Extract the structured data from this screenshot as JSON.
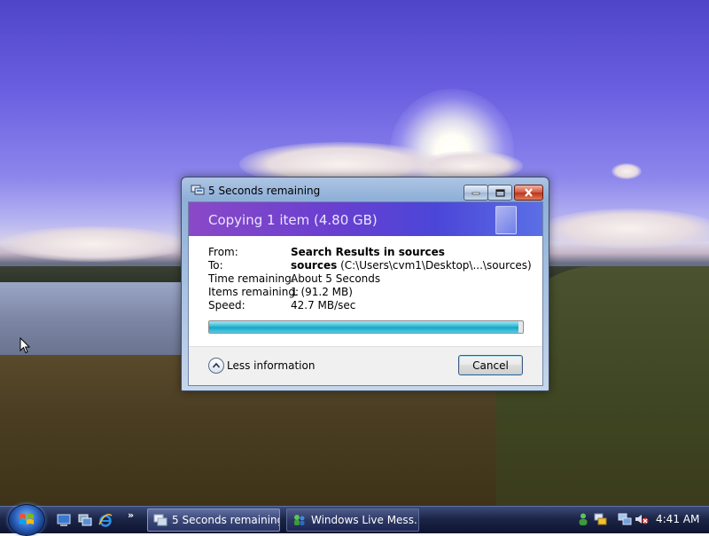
{
  "dialog": {
    "title": "5 Seconds remaining",
    "heading": "Copying 1 item (4.80 GB)",
    "from_label": "From:",
    "from_value": "Search Results in sources",
    "to_label": "To:",
    "to_value_bold": "sources",
    "to_value_path": "(C:\\Users\\cvm1\\Desktop\\...\\sources)",
    "time_label": "Time remaining:",
    "time_value": "About 5 Seconds",
    "items_label": "Items remaining:",
    "items_value": "1 (91.2 MB)",
    "speed_label": "Speed:",
    "speed_value": "42.7 MB/sec",
    "progress_fraction": 0.985,
    "less_info_label": "Less information",
    "cancel_label": "Cancel"
  },
  "taskbar": {
    "quick_launch": [
      "show-desktop-icon",
      "switch-windows-icon",
      "internet-explorer-icon"
    ],
    "overflow_label": "»",
    "tasks": [
      {
        "label": "5 Seconds remaining",
        "icon": "copy-icon"
      },
      {
        "label": "Windows Live Mess...",
        "icon": "messenger-icon"
      }
    ],
    "tray_icons": [
      "messenger-status-icon",
      "network-status-icon",
      "network-icon",
      "volume-muted-icon"
    ],
    "clock": "4:41 AM"
  }
}
